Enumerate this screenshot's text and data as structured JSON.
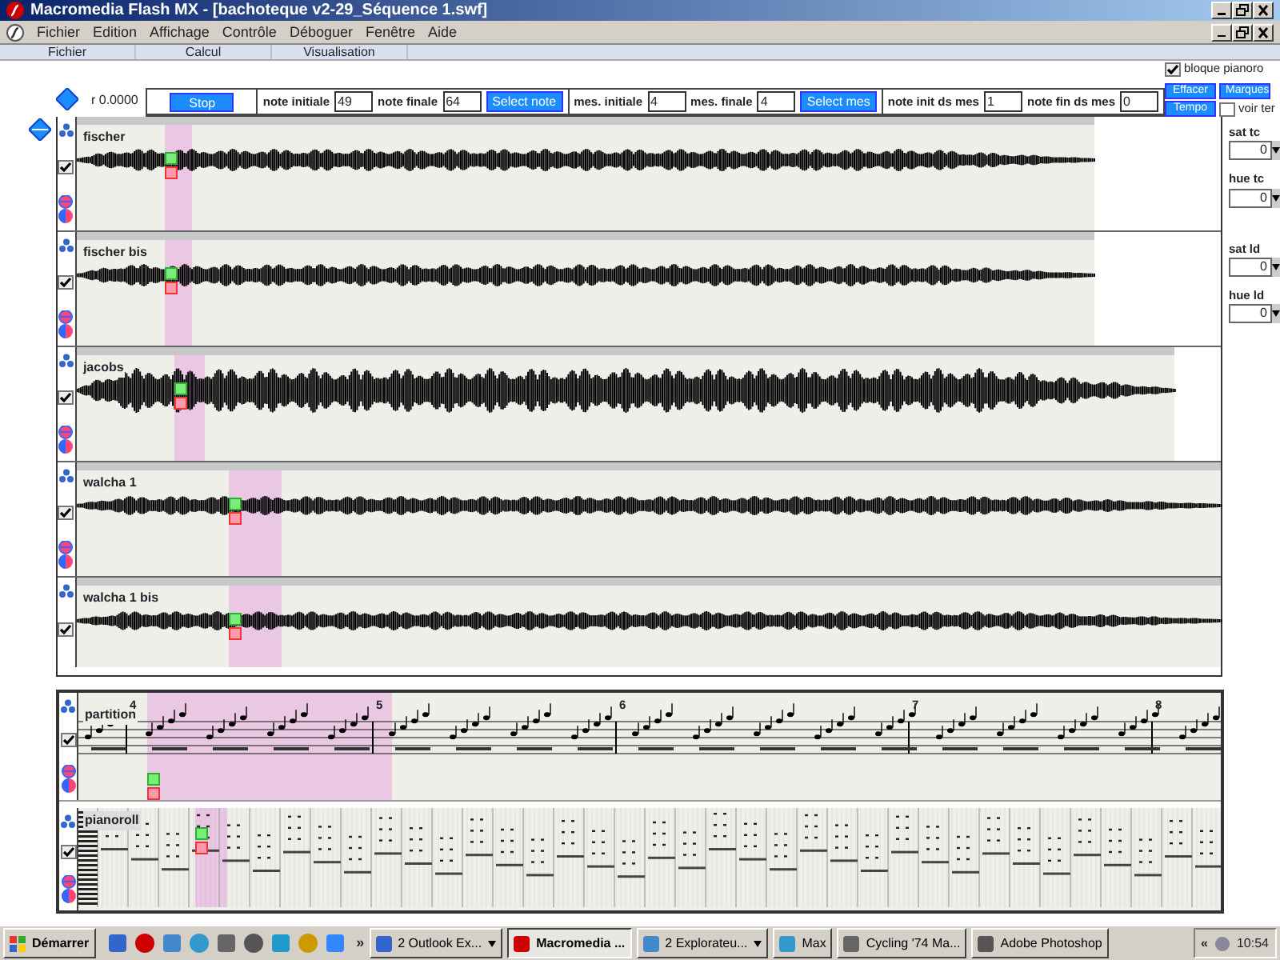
{
  "window": {
    "title": "Macromedia Flash MX - [bachoteque v2-29_Séquence 1.swf]"
  },
  "menu": [
    "Fichier",
    "Edition",
    "Affichage",
    "Contrôle",
    "Déboguer",
    "Fenêtre",
    "Aide"
  ],
  "panel_tabs": [
    "Fichier",
    "Calcul",
    "Visualisation"
  ],
  "readout": "r 0.0000",
  "controls": [
    [
      {
        "kind": "button",
        "label": "Stop"
      }
    ],
    [
      {
        "kind": "field",
        "label": "note initiale",
        "value": "49"
      },
      {
        "kind": "field",
        "label": "note finale",
        "value": "64"
      },
      {
        "kind": "button",
        "label": "Select note"
      }
    ],
    [
      {
        "kind": "field",
        "label": "mes. initiale",
        "value": "4"
      },
      {
        "kind": "field",
        "label": "mes. finale",
        "value": "4"
      },
      {
        "kind": "button",
        "label": "Select mes"
      }
    ],
    [
      {
        "kind": "field",
        "label": "note init ds mes",
        "value": "1"
      },
      {
        "kind": "field",
        "label": "note fin ds mes",
        "value": "0"
      }
    ]
  ],
  "options": {
    "lock": {
      "label": "bloque pianoro",
      "checked": true
    },
    "buttons": [
      "Effacer",
      "Marques",
      "Tempo"
    ],
    "show": {
      "label": "voir ter",
      "checked": false
    }
  },
  "tracks": [
    {
      "name": "fischer",
      "checked": true
    },
    {
      "name": "fischer bis",
      "checked": true
    },
    {
      "name": "jacobs",
      "checked": true
    },
    {
      "name": "walcha 1",
      "checked": true
    },
    {
      "name": "walcha 1 bis",
      "checked": true
    }
  ],
  "spinners": [
    {
      "label": "sat tc",
      "value": "0"
    },
    {
      "label": "hue tc",
      "value": "0"
    },
    {
      "label": "sat ld",
      "value": "0"
    },
    {
      "label": "hue ld",
      "value": "0"
    }
  ],
  "score": {
    "name": "partition",
    "checked": true,
    "measures": [
      "4",
      "5",
      "6",
      "7",
      "8"
    ]
  },
  "pianoroll": {
    "name": "pianoroll",
    "checked": true
  },
  "taskbar": {
    "start": "Démarrer",
    "more": "»",
    "tasks": [
      {
        "label": "2 Outlook Ex...",
        "selected": false,
        "grouped": true
      },
      {
        "label": "Macromedia ...",
        "selected": true,
        "grouped": false
      },
      {
        "label": "2 Explorateu...",
        "selected": false,
        "grouped": true
      },
      {
        "label": "Max",
        "selected": false,
        "grouped": false
      },
      {
        "label": "Cycling '74 Ma...",
        "selected": false,
        "grouped": false
      },
      {
        "label": "Adobe Photoshop",
        "selected": false,
        "grouped": false
      }
    ],
    "tray_toggle": "«",
    "clock": "10:54"
  }
}
